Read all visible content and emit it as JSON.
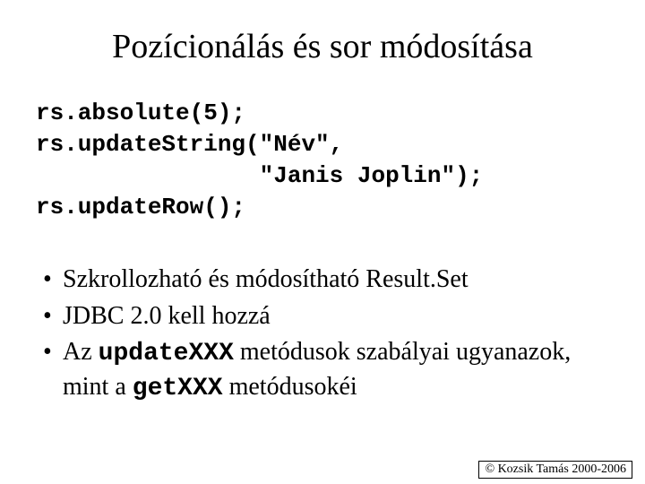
{
  "title": "Pozícionálás és sor módosítása",
  "code": {
    "line1": "rs.absolute(5);",
    "line2": "rs.updateString(\"Név\",",
    "line3": "                \"Janis Joplin\");",
    "line4": "rs.updateRow();"
  },
  "bullets": {
    "b1": "Szkrollozható és módosítható Result.Set",
    "b2": "JDBC 2.0 kell hozzá",
    "b3_pre": "Az ",
    "b3_code1": "updateXXX",
    "b3_mid": " metódusok szabályai ugyanazok, mint a ",
    "b3_code2": "getXXX",
    "b3_post": " metódusokéi"
  },
  "footer": "© Kozsik Tamás 2000-2006"
}
